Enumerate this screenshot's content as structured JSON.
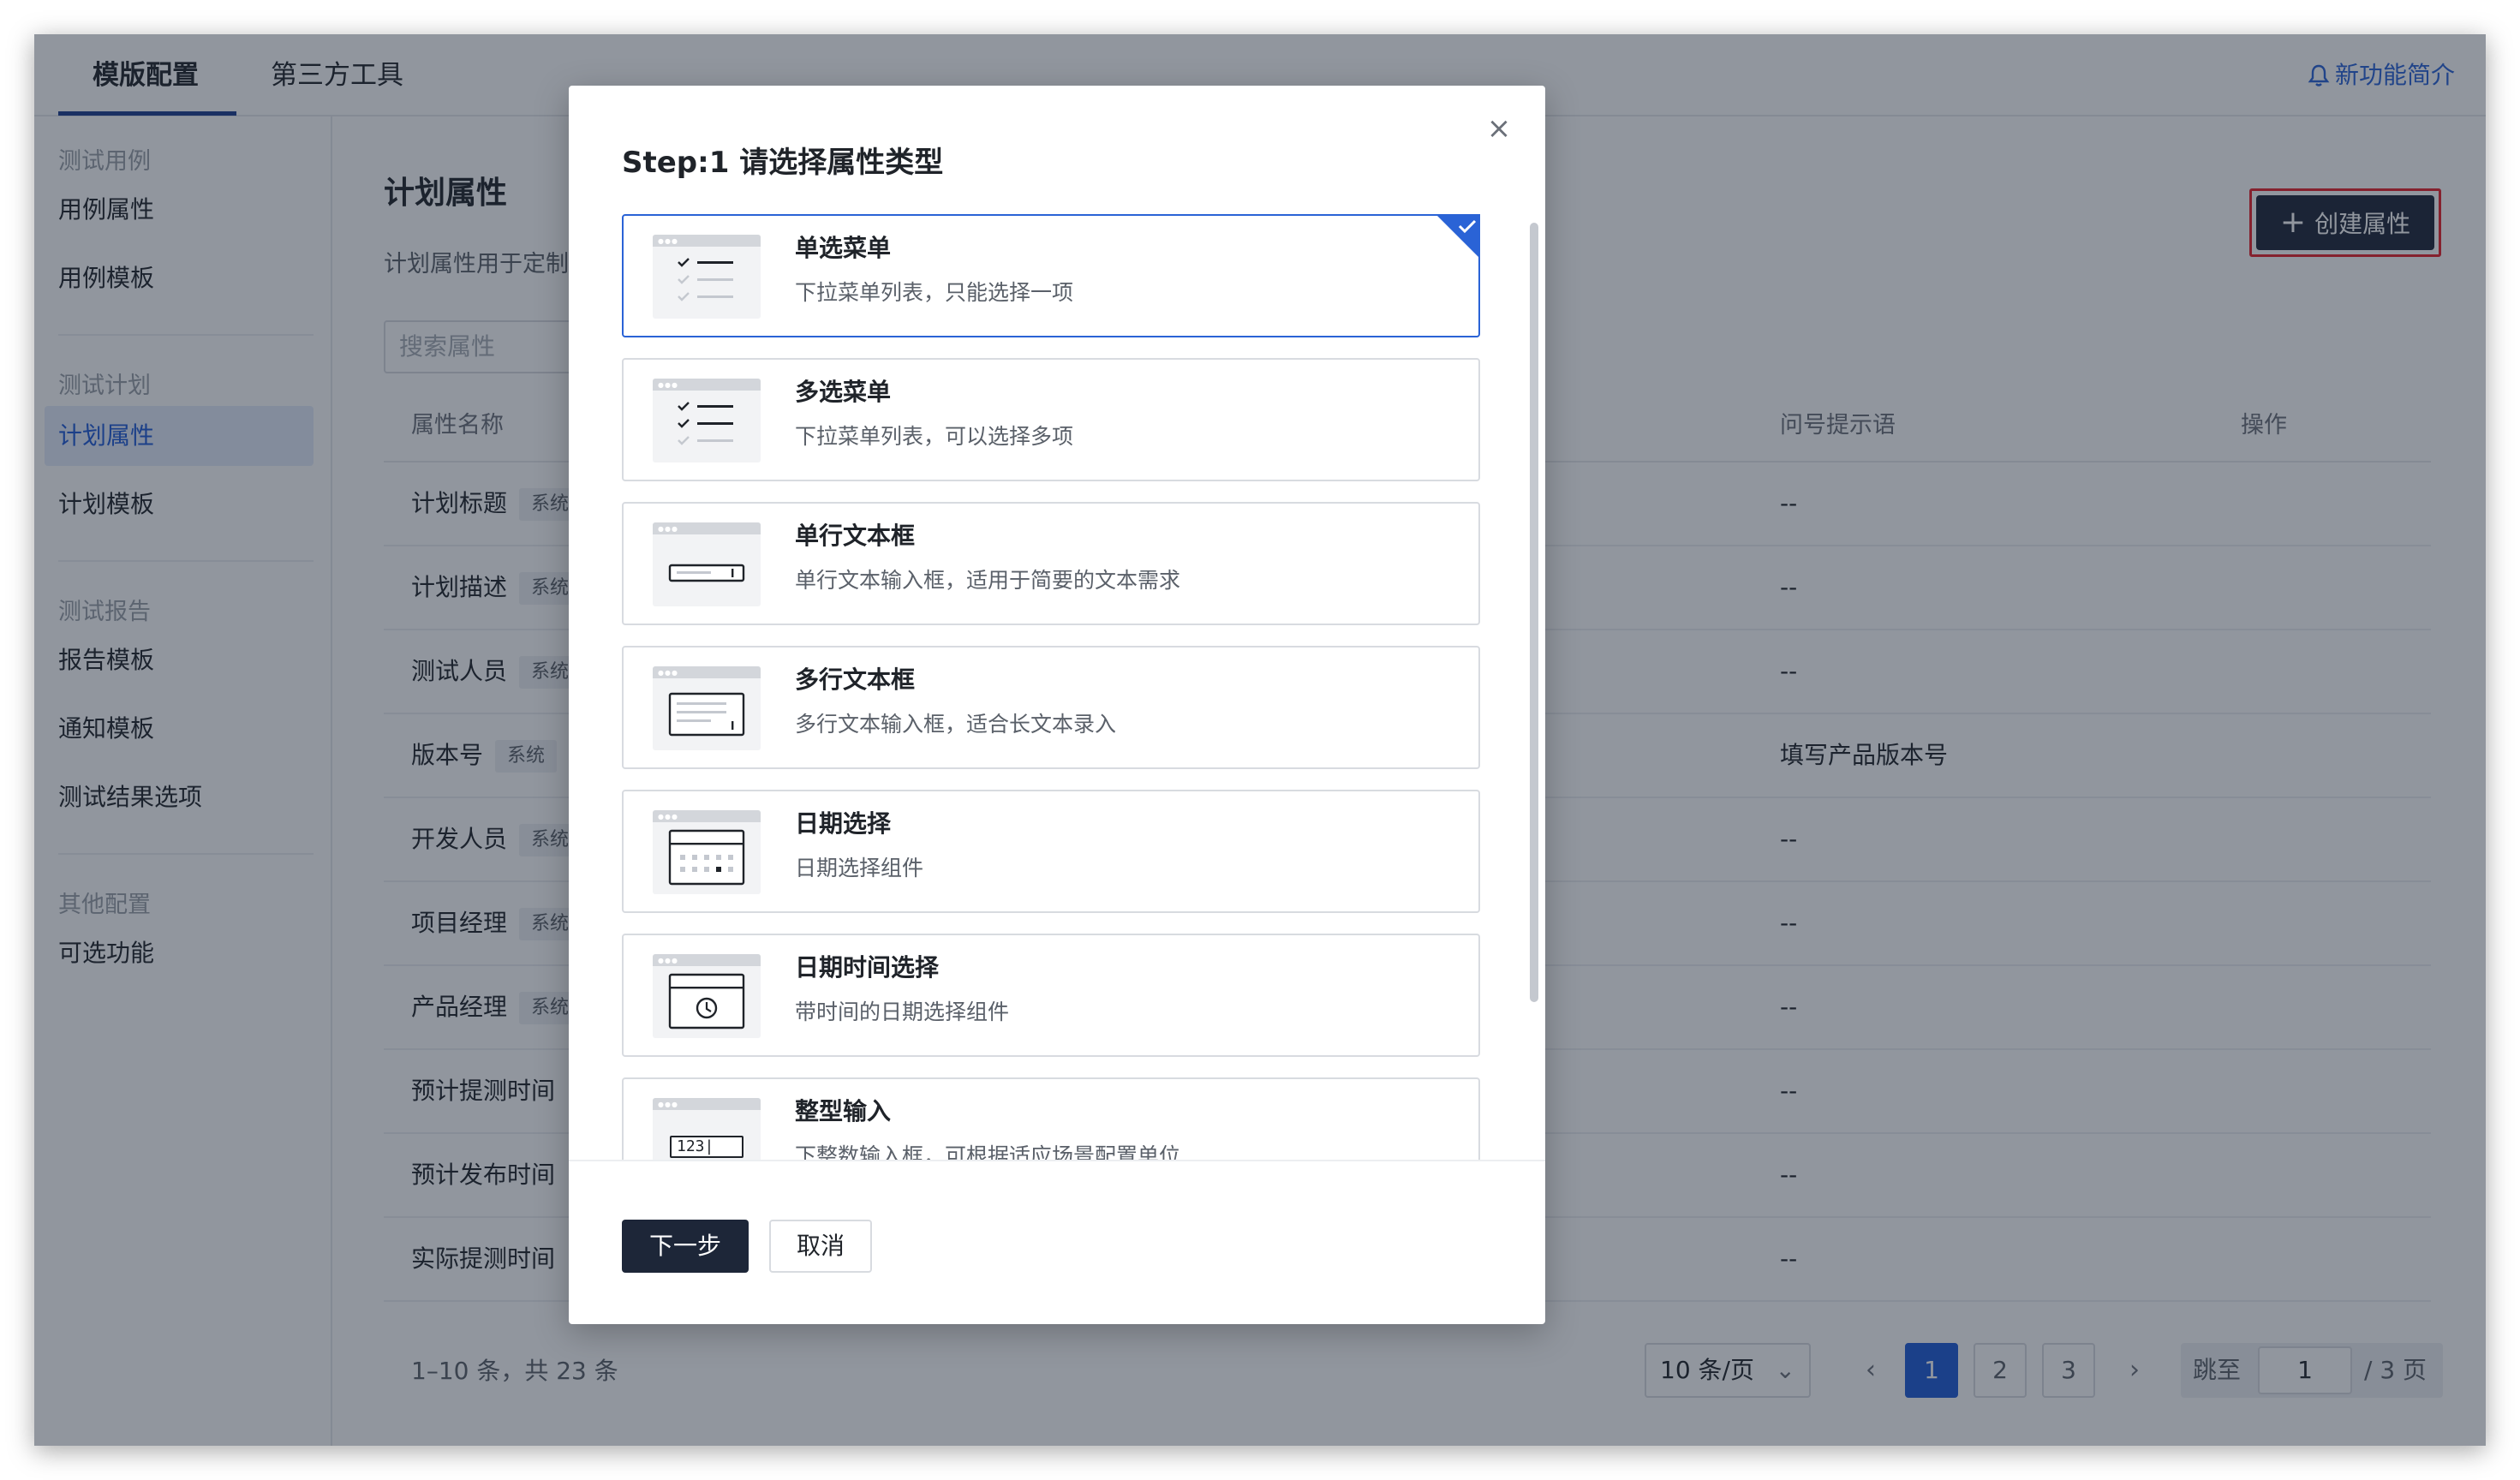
{
  "tabs": [
    {
      "label": "模版配置"
    },
    {
      "label": "第三方工具"
    }
  ],
  "feature_link": "新功能简介",
  "sidebar": {
    "groups": [
      {
        "label": "测试用例",
        "items": [
          "用例属性",
          "用例模板"
        ]
      },
      {
        "label": "测试计划",
        "items": [
          "计划属性",
          "计划模板"
        ]
      },
      {
        "label": "测试报告",
        "items": [
          "报告模板",
          "通知模板",
          "测试结果选项"
        ]
      },
      {
        "label": "其他配置",
        "items": [
          "可选功能"
        ]
      }
    ],
    "active_item": "计划属性"
  },
  "main": {
    "title": "计划属性",
    "description": "计划属性用于定制",
    "search_placeholder": "搜索属性",
    "create_button": "创建属性",
    "columns": {
      "name": "属性名称",
      "hint": "问号提示语",
      "action": "操作"
    },
    "rows": [
      {
        "name": "计划标题",
        "tag": "系统",
        "hint": "--"
      },
      {
        "name": "计划描述",
        "tag": "系统",
        "hint": "--"
      },
      {
        "name": "测试人员",
        "tag": "系统",
        "hint": "--"
      },
      {
        "name": "版本号",
        "tag": "系统",
        "hint": "填写产品版本号"
      },
      {
        "name": "开发人员",
        "tag": "系统",
        "hint": "--"
      },
      {
        "name": "项目经理",
        "tag": "系统",
        "hint": "--"
      },
      {
        "name": "产品经理",
        "tag": "系统",
        "hint": "--"
      },
      {
        "name": "预计提测时间",
        "tag": "",
        "hint": "--"
      },
      {
        "name": "预计发布时间",
        "tag": "",
        "hint": "--"
      },
      {
        "name": "实际提测时间",
        "tag": "",
        "hint": "--"
      }
    ],
    "pagination": {
      "total_text": "1–10 条，共 23 条",
      "page_size": "10 条/页",
      "pages": [
        "1",
        "2",
        "3"
      ],
      "current_page": "1",
      "prev": "‹",
      "next": "›",
      "jump_label": "跳至",
      "jump_value": "1",
      "jump_total": "/ 3 页"
    }
  },
  "modal": {
    "title": "Step:1 请选择属性类型",
    "close": "×",
    "selected_index": 0,
    "options": [
      {
        "title": "单选菜单",
        "desc": "下拉菜单列表，只能选择一项",
        "icon": "single-select-icon"
      },
      {
        "title": "多选菜单",
        "desc": "下拉菜单列表，可以选择多项",
        "icon": "multi-select-icon"
      },
      {
        "title": "单行文本框",
        "desc": "单行文本输入框，适用于简要的文本需求",
        "icon": "single-line-text-icon"
      },
      {
        "title": "多行文本框",
        "desc": "多行文本输入框，适合长文本录入",
        "icon": "multi-line-text-icon"
      },
      {
        "title": "日期选择",
        "desc": "日期选择组件",
        "icon": "date-picker-icon"
      },
      {
        "title": "日期时间选择",
        "desc": "带时间的日期选择组件",
        "icon": "datetime-picker-icon"
      },
      {
        "title": "整型输入",
        "desc": "下整数输入框，可根据适应场景配置单位",
        "icon": "integer-input-icon",
        "icon_text": "123|"
      }
    ],
    "next_button": "下一步",
    "cancel_button": "取消"
  },
  "colors": {
    "accent": "#1e5ad6",
    "dark_button": "#1d2638",
    "highlight_outline": "#e8202a",
    "overlay": "#1a2334"
  }
}
